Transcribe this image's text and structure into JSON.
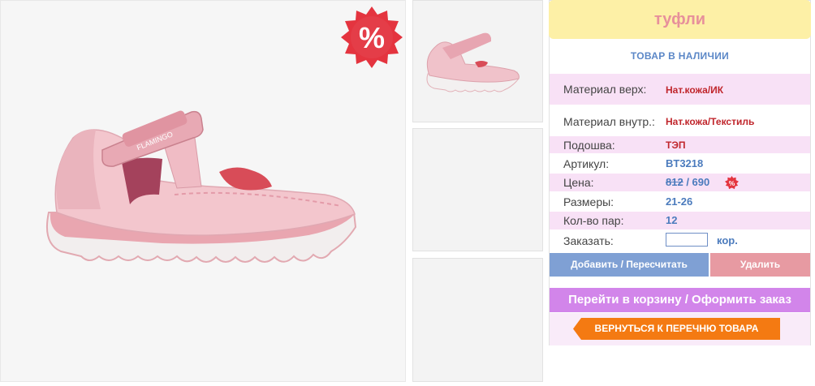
{
  "product": {
    "title": "туфли",
    "stock_status": "ТОВАР В НАЛИЧИИ",
    "brand_on_strap": "FLAMINGO",
    "promo_icon_text": "%"
  },
  "specs": {
    "material_top": {
      "label": "Материал верх:",
      "value": "Нат.кожа/ИК"
    },
    "material_inner": {
      "label": "Материал внутр.:",
      "value": "Нат.кожа/Текстиль"
    },
    "sole": {
      "label": "Подошва:",
      "value": "ТЭП"
    },
    "article": {
      "label": "Артикул:",
      "value": "BT3218"
    },
    "price": {
      "label": "Цена:",
      "old_value": "812",
      "separator": " / ",
      "new_value": "690"
    },
    "sizes": {
      "label": "Размеры:",
      "value": "21-26"
    },
    "pairs": {
      "label": "Кол-во пар:",
      "value": "12"
    },
    "order": {
      "label": "Заказать:",
      "input_value": "",
      "unit": "кор."
    }
  },
  "buttons": {
    "add": "Добавить / Пересчитать",
    "delete": "Удалить",
    "cart": "Перейти в корзину / Оформить заказ",
    "back": "ВЕРНУТЬСЯ К ПЕРЕЧНЮ ТОВАРА"
  },
  "colors": {
    "title_bg": "#fdf0a6",
    "title_text": "#e7909b",
    "row_shade": "#f8e1f6",
    "add_button": "#7fa0d4",
    "delete_button": "#e79aa2",
    "cart_button": "#d285ea",
    "back_button": "#f47a12",
    "promo_badge": "#e4343f"
  }
}
